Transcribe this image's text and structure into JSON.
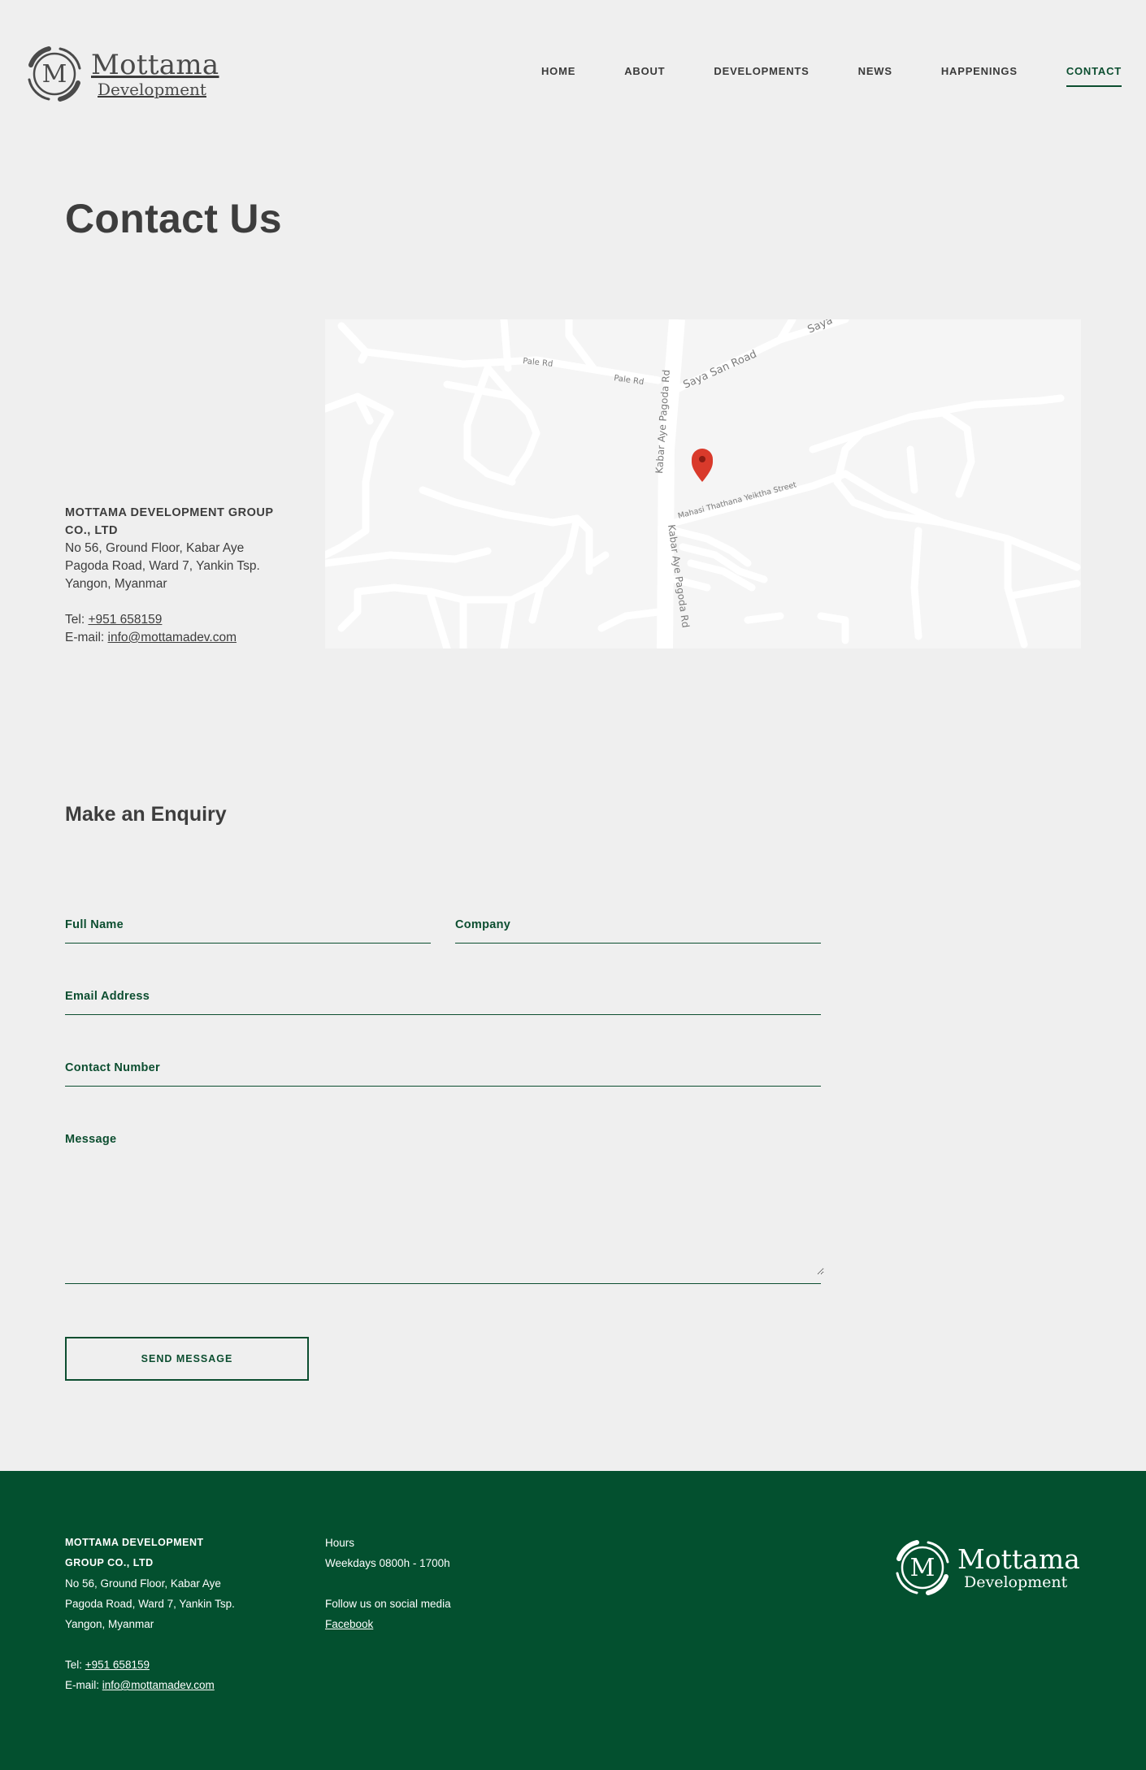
{
  "brand": {
    "name_line1": "Mottama",
    "name_line2": "Development"
  },
  "nav": {
    "items": [
      {
        "label": "HOME"
      },
      {
        "label": "ABOUT"
      },
      {
        "label": "DEVELOPMENTS"
      },
      {
        "label": "NEWS"
      },
      {
        "label": "HAPPENINGS"
      },
      {
        "label": "CONTACT",
        "active": true
      }
    ]
  },
  "page": {
    "title": "Contact Us"
  },
  "contact": {
    "company_line1": "MOTTAMA DEVELOPMENT GROUP",
    "company_line2": "CO., LTD",
    "address_line1": "No 56, Ground Floor, Kabar Aye",
    "address_line2": "Pagoda Road, Ward 7, Yankin Tsp.",
    "address_line3": "Yangon, Myanmar",
    "tel_label": "Tel: ",
    "tel": "+951 658159",
    "email_label": "E-mail: ",
    "email": "info@mottamadev.com"
  },
  "map": {
    "labels": {
      "pale_rd_1": "Pale Rd",
      "pale_rd_2": "Pale Rd",
      "saya_san_road": "Saya San Road",
      "saya_top": "Saya",
      "kabar_aye_1": "Kabar Aye Pagoda Rd",
      "kabar_aye_2": "Kabar Aye Pagoda Rd",
      "mahasi": "Mahasi Thathana Yeiktha Street"
    },
    "pin_color": "#d93a2b"
  },
  "enquiry": {
    "title": "Make an Enquiry",
    "full_name_label": "Full Name",
    "company_label": "Company",
    "email_label": "Email Address",
    "contact_label": "Contact Number",
    "message_label": "Message",
    "send_label": "SEND MESSAGE"
  },
  "footer": {
    "company_line1": "MOTTAMA DEVELOPMENT",
    "company_line2": "GROUP CO., LTD",
    "address_line1": "No 56, Ground Floor, Kabar Aye",
    "address_line2": "Pagoda Road, Ward 7, Yankin Tsp.",
    "address_line3": "Yangon, Myanmar",
    "tel_label": "Tel: ",
    "tel": "+951 658159",
    "email_label": "E-mail: ",
    "email": "info@mottamadev.com",
    "hours_label": "Hours",
    "hours_value": "Weekdays 0800h - 1700h",
    "social_label": "Follow us on social media",
    "facebook": "Facebook"
  },
  "colors": {
    "brand_green": "#0c4e30",
    "footer_bg": "#03502f",
    "page_bg": "#efefef"
  }
}
